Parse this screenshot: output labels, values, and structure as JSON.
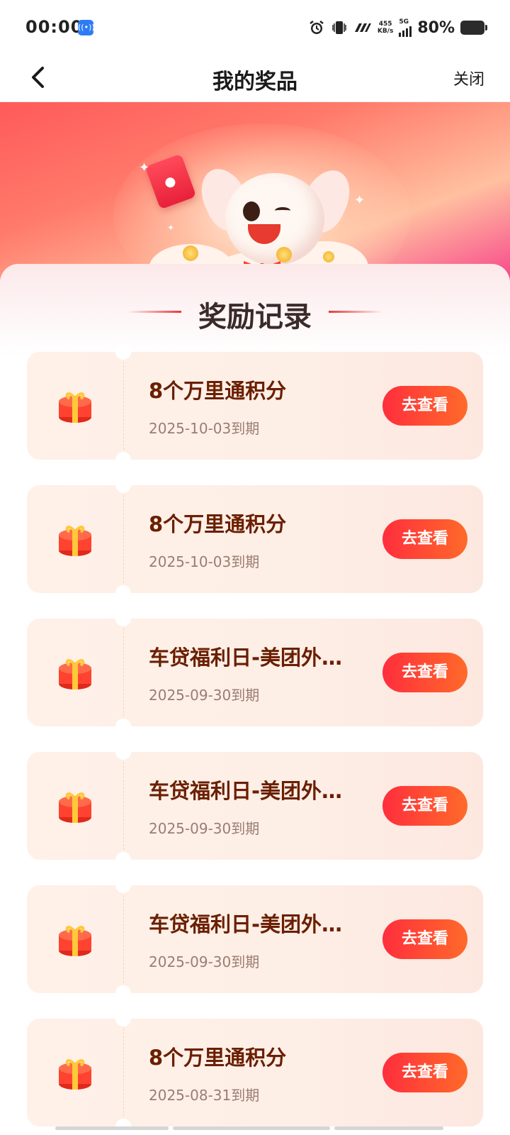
{
  "status_bar": {
    "time": "00:00",
    "net_speed_value": "455",
    "net_speed_unit": "KB/s",
    "network_type": "5G",
    "battery_percent": "80%"
  },
  "nav": {
    "title": "我的奖品",
    "close_label": "关闭"
  },
  "section": {
    "title": "奖励记录"
  },
  "rewards": [
    {
      "title": "8个万里通积分",
      "expiry": "2025-10-03到期",
      "button": "去查看"
    },
    {
      "title": "8个万里通积分",
      "expiry": "2025-10-03到期",
      "button": "去查看"
    },
    {
      "title": "车贷福利日-美团外卖红包",
      "expiry": "2025-09-30到期",
      "button": "去查看"
    },
    {
      "title": "车贷福利日-美团外卖红包",
      "expiry": "2025-09-30到期",
      "button": "去查看"
    },
    {
      "title": "车贷福利日-美团外卖红包",
      "expiry": "2025-09-30到期",
      "button": "去查看"
    },
    {
      "title": "8个万里通积分",
      "expiry": "2025-08-31到期",
      "button": "去查看"
    }
  ],
  "colors": {
    "accent": "#ff3a3a",
    "title_text": "#6a1f00",
    "card_bg": "#fdeee6"
  }
}
